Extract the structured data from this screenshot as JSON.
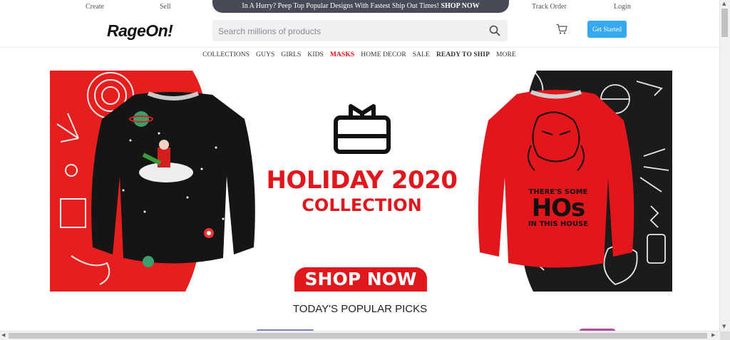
{
  "topbar": {
    "create": "Create",
    "sell": "Sell",
    "promo_text": "In A Hurry? Peep Top Popular Designs With Fastest Ship Out Times!",
    "promo_cta": "SHOP NOW",
    "track_order": "Track Order",
    "login": "Login"
  },
  "header": {
    "logo": "RageOn!",
    "search_placeholder": "Search millions of products",
    "cta_label": "Get Started",
    "icons": [
      "search-icon",
      "cart-icon"
    ],
    "cta_color": "#37a9f0"
  },
  "nav": {
    "items": [
      {
        "label": "COLLECTIONS"
      },
      {
        "label": "GUYS"
      },
      {
        "label": "GIRLS"
      },
      {
        "label": "KIDS"
      },
      {
        "label": "MASKS"
      },
      {
        "label": "HOME DECOR"
      },
      {
        "label": "SALE"
      },
      {
        "label": "READY TO SHIP"
      },
      {
        "label": "MORE"
      }
    ],
    "highlight_color": "#e01818"
  },
  "banner": {
    "line1": "HOLIDAY 2020",
    "line2": "COLLECTION",
    "button": "SHOP NOW",
    "sweater_text_line1": "THERE'S SOME",
    "sweater_text_line2": "HOs",
    "sweater_text_line3": "IN THIS HOUSE",
    "brand_color": "#e0171c"
  },
  "section": {
    "title": "TODAY'S POPULAR PICKS"
  }
}
